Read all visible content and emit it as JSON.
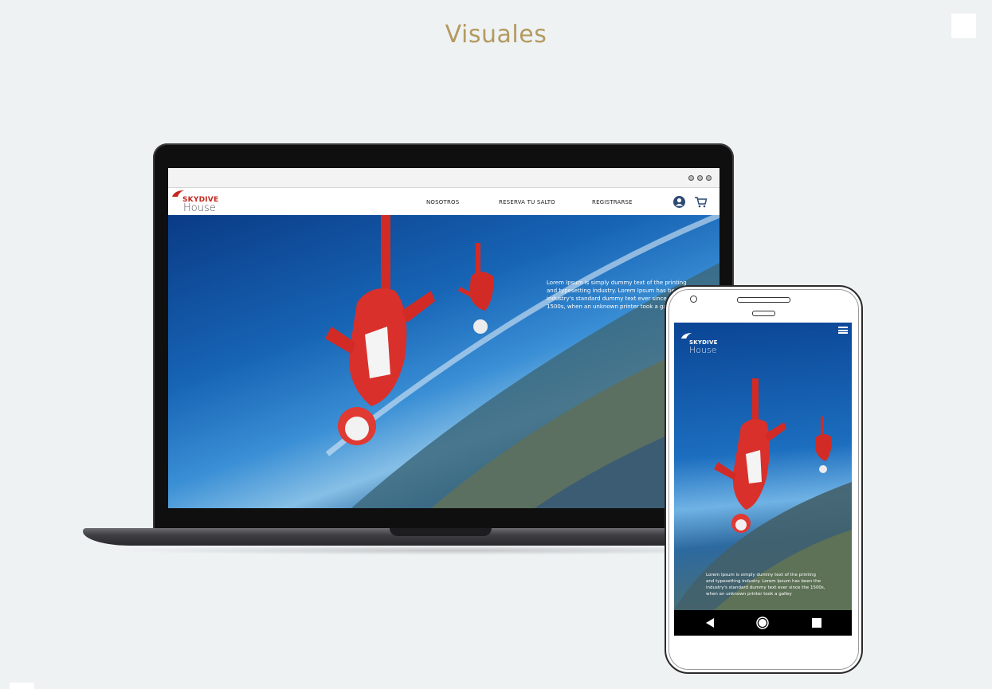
{
  "page": {
    "title": "Visuales",
    "accent_color": "#b49a60",
    "background_color": "#eef2f3"
  },
  "laptop": {
    "browser_menu_icon": "three-dots-icon",
    "site": {
      "logo_word_top": "SKYDIVE",
      "logo_word_bottom": "House",
      "nav": [
        "NOSOTROS",
        "RESERVA TU SALTO",
        "REGISTRARSE"
      ],
      "icons": [
        "user-icon",
        "cart-icon"
      ],
      "hero_text": "Lorem Ipsum is simply dummy text of the printing and typesetting industry. Lorem Ipsum has been the industry's standard dummy text ever since the 1500s, when an unknown printer took a galley",
      "brand_color": "#c3281f"
    }
  },
  "phone": {
    "logo_word_top": "SKYDIVE",
    "logo_word_bottom": "House",
    "menu_icon": "hamburger-icon",
    "hero_text": "Lorem Ipsum is simply dummy text of the printing and typesetting industry. Lorem Ipsum has been the industry's standard dummy text ever since the 1500s, when an unknown printer took a galley",
    "nav_buttons": [
      "back-icon",
      "home-icon",
      "recents-icon"
    ]
  }
}
